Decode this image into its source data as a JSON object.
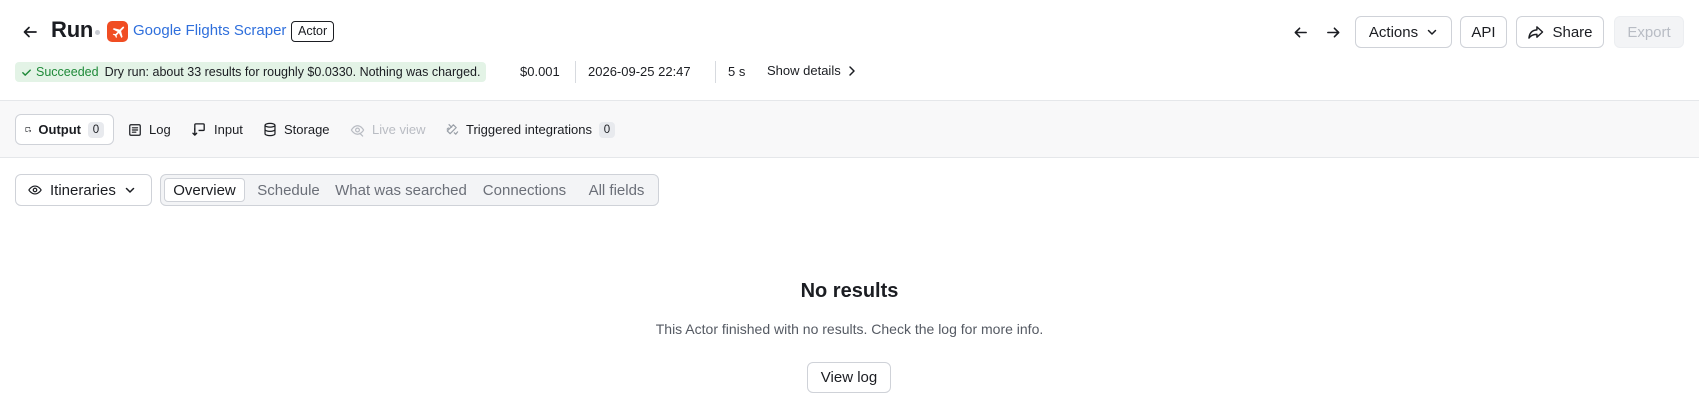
{
  "header": {
    "title": "Run",
    "actor_name": "Google Flights Scraper",
    "actor_badge": "Actor",
    "buttons": {
      "actions": "Actions",
      "api": "API",
      "share": "Share",
      "export": "Export"
    }
  },
  "status": {
    "state": "Succeeded",
    "message": "Dry run: about 33 results for roughly $0.0330. Nothing was charged.",
    "cost": "$0.001",
    "timestamp": "2026-09-25 22:47",
    "duration": "5 s",
    "show_details": "Show details"
  },
  "tabs": [
    {
      "label": "Output",
      "count": "0"
    },
    {
      "label": "Log"
    },
    {
      "label": "Input"
    },
    {
      "label": "Storage"
    },
    {
      "label": "Live view"
    },
    {
      "label": "Triggered integrations",
      "count": "0"
    }
  ],
  "views": {
    "selected": "Itineraries",
    "segments": [
      "Overview",
      "Schedule",
      "What was searched",
      "Connections",
      "All fields"
    ]
  },
  "empty_state": {
    "title": "No results",
    "description": "This Actor finished with no results. Check the log for more info.",
    "button": "View log"
  },
  "colors": {
    "brand_orange": "#f04d23",
    "link_blue": "#2f6fdc",
    "success_green": "#1f8a39",
    "success_bg": "#e3f3e6"
  }
}
